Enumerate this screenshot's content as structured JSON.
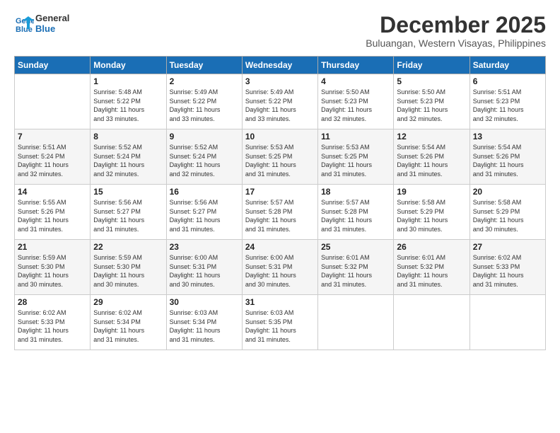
{
  "logo": {
    "line1": "General",
    "line2": "Blue"
  },
  "title": "December 2025",
  "location": "Buluangan, Western Visayas, Philippines",
  "days_header": [
    "Sunday",
    "Monday",
    "Tuesday",
    "Wednesday",
    "Thursday",
    "Friday",
    "Saturday"
  ],
  "weeks": [
    [
      {
        "num": "",
        "info": ""
      },
      {
        "num": "1",
        "info": "Sunrise: 5:48 AM\nSunset: 5:22 PM\nDaylight: 11 hours\nand 33 minutes."
      },
      {
        "num": "2",
        "info": "Sunrise: 5:49 AM\nSunset: 5:22 PM\nDaylight: 11 hours\nand 33 minutes."
      },
      {
        "num": "3",
        "info": "Sunrise: 5:49 AM\nSunset: 5:22 PM\nDaylight: 11 hours\nand 33 minutes."
      },
      {
        "num": "4",
        "info": "Sunrise: 5:50 AM\nSunset: 5:23 PM\nDaylight: 11 hours\nand 32 minutes."
      },
      {
        "num": "5",
        "info": "Sunrise: 5:50 AM\nSunset: 5:23 PM\nDaylight: 11 hours\nand 32 minutes."
      },
      {
        "num": "6",
        "info": "Sunrise: 5:51 AM\nSunset: 5:23 PM\nDaylight: 11 hours\nand 32 minutes."
      }
    ],
    [
      {
        "num": "7",
        "info": "Sunrise: 5:51 AM\nSunset: 5:24 PM\nDaylight: 11 hours\nand 32 minutes."
      },
      {
        "num": "8",
        "info": "Sunrise: 5:52 AM\nSunset: 5:24 PM\nDaylight: 11 hours\nand 32 minutes."
      },
      {
        "num": "9",
        "info": "Sunrise: 5:52 AM\nSunset: 5:24 PM\nDaylight: 11 hours\nand 32 minutes."
      },
      {
        "num": "10",
        "info": "Sunrise: 5:53 AM\nSunset: 5:25 PM\nDaylight: 11 hours\nand 31 minutes."
      },
      {
        "num": "11",
        "info": "Sunrise: 5:53 AM\nSunset: 5:25 PM\nDaylight: 11 hours\nand 31 minutes."
      },
      {
        "num": "12",
        "info": "Sunrise: 5:54 AM\nSunset: 5:26 PM\nDaylight: 11 hours\nand 31 minutes."
      },
      {
        "num": "13",
        "info": "Sunrise: 5:54 AM\nSunset: 5:26 PM\nDaylight: 11 hours\nand 31 minutes."
      }
    ],
    [
      {
        "num": "14",
        "info": "Sunrise: 5:55 AM\nSunset: 5:26 PM\nDaylight: 11 hours\nand 31 minutes."
      },
      {
        "num": "15",
        "info": "Sunrise: 5:56 AM\nSunset: 5:27 PM\nDaylight: 11 hours\nand 31 minutes."
      },
      {
        "num": "16",
        "info": "Sunrise: 5:56 AM\nSunset: 5:27 PM\nDaylight: 11 hours\nand 31 minutes."
      },
      {
        "num": "17",
        "info": "Sunrise: 5:57 AM\nSunset: 5:28 PM\nDaylight: 11 hours\nand 31 minutes."
      },
      {
        "num": "18",
        "info": "Sunrise: 5:57 AM\nSunset: 5:28 PM\nDaylight: 11 hours\nand 31 minutes."
      },
      {
        "num": "19",
        "info": "Sunrise: 5:58 AM\nSunset: 5:29 PM\nDaylight: 11 hours\nand 30 minutes."
      },
      {
        "num": "20",
        "info": "Sunrise: 5:58 AM\nSunset: 5:29 PM\nDaylight: 11 hours\nand 30 minutes."
      }
    ],
    [
      {
        "num": "21",
        "info": "Sunrise: 5:59 AM\nSunset: 5:30 PM\nDaylight: 11 hours\nand 30 minutes."
      },
      {
        "num": "22",
        "info": "Sunrise: 5:59 AM\nSunset: 5:30 PM\nDaylight: 11 hours\nand 30 minutes."
      },
      {
        "num": "23",
        "info": "Sunrise: 6:00 AM\nSunset: 5:31 PM\nDaylight: 11 hours\nand 30 minutes."
      },
      {
        "num": "24",
        "info": "Sunrise: 6:00 AM\nSunset: 5:31 PM\nDaylight: 11 hours\nand 30 minutes."
      },
      {
        "num": "25",
        "info": "Sunrise: 6:01 AM\nSunset: 5:32 PM\nDaylight: 11 hours\nand 31 minutes."
      },
      {
        "num": "26",
        "info": "Sunrise: 6:01 AM\nSunset: 5:32 PM\nDaylight: 11 hours\nand 31 minutes."
      },
      {
        "num": "27",
        "info": "Sunrise: 6:02 AM\nSunset: 5:33 PM\nDaylight: 11 hours\nand 31 minutes."
      }
    ],
    [
      {
        "num": "28",
        "info": "Sunrise: 6:02 AM\nSunset: 5:33 PM\nDaylight: 11 hours\nand 31 minutes."
      },
      {
        "num": "29",
        "info": "Sunrise: 6:02 AM\nSunset: 5:34 PM\nDaylight: 11 hours\nand 31 minutes."
      },
      {
        "num": "30",
        "info": "Sunrise: 6:03 AM\nSunset: 5:34 PM\nDaylight: 11 hours\nand 31 minutes."
      },
      {
        "num": "31",
        "info": "Sunrise: 6:03 AM\nSunset: 5:35 PM\nDaylight: 11 hours\nand 31 minutes."
      },
      {
        "num": "",
        "info": ""
      },
      {
        "num": "",
        "info": ""
      },
      {
        "num": "",
        "info": ""
      }
    ]
  ]
}
